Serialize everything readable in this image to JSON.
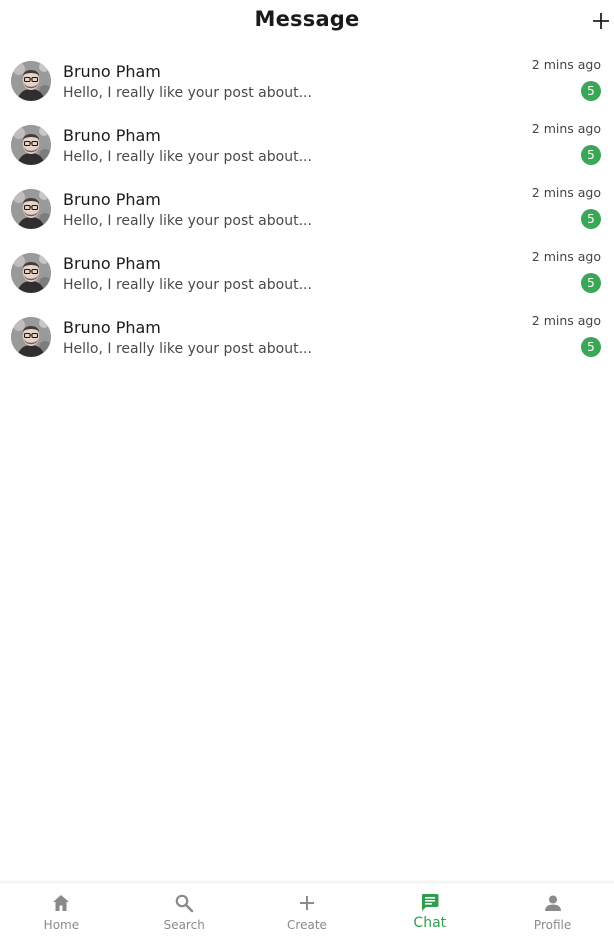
{
  "header": {
    "title": "Message",
    "add_icon": "plus-icon"
  },
  "messages": [
    {
      "name": "Bruno Pham",
      "preview": "Hello, I really like your post about...",
      "time": "2 mins ago",
      "unread": "5"
    },
    {
      "name": "Bruno Pham",
      "preview": "Hello, I really like your post about...",
      "time": "2 mins ago",
      "unread": "5"
    },
    {
      "name": "Bruno Pham",
      "preview": "Hello, I really like your post about...",
      "time": "2 mins ago",
      "unread": "5"
    },
    {
      "name": "Bruno Pham",
      "preview": "Hello, I really like your post about...",
      "time": "2 mins ago",
      "unread": "5"
    },
    {
      "name": "Bruno Pham",
      "preview": "Hello, I really like your post about...",
      "time": "2 mins ago",
      "unread": "5"
    }
  ],
  "bottom_nav": {
    "items": [
      {
        "label": "Home",
        "icon": "home-icon"
      },
      {
        "label": "Search",
        "icon": "search-icon"
      },
      {
        "label": "Create",
        "icon": "plus-icon"
      },
      {
        "label": "Chat",
        "icon": "chat-icon"
      },
      {
        "label": "Profile",
        "icon": "person-icon"
      }
    ],
    "active": "Chat"
  },
  "colors": {
    "accent": "#2e9e4f",
    "badge": "#3aa757",
    "inactive": "#8a8a8a"
  }
}
